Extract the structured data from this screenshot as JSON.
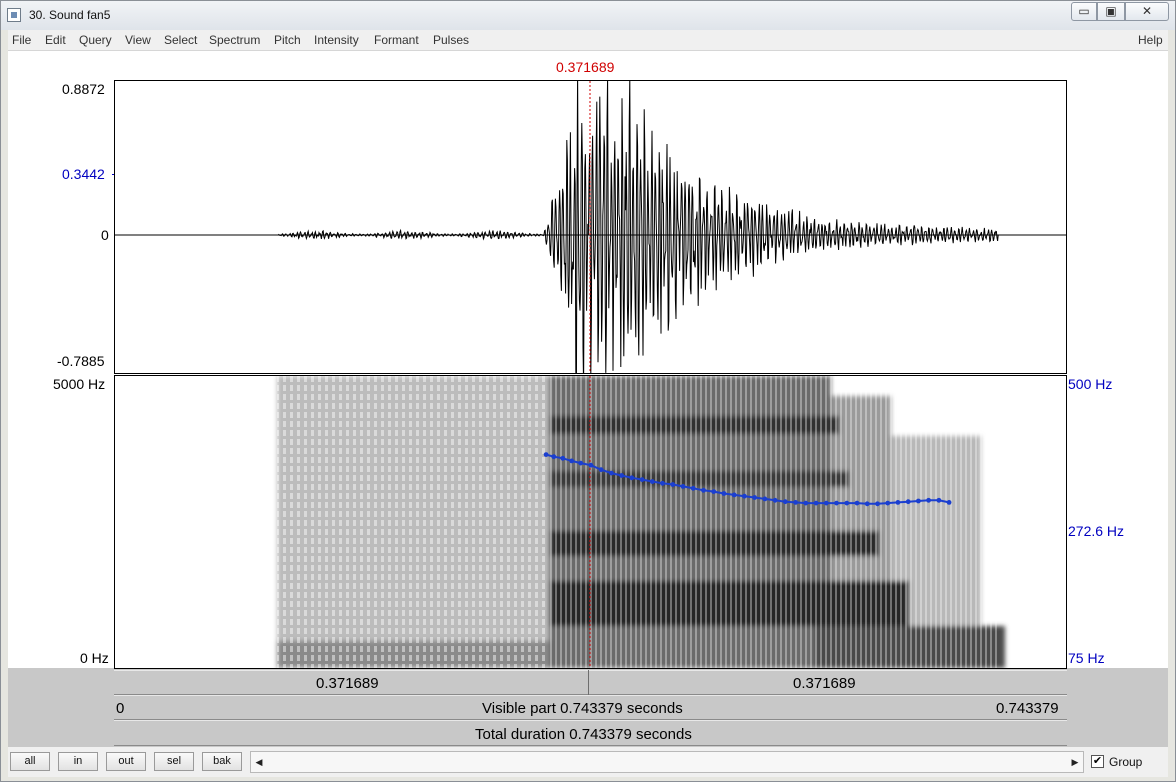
{
  "window": {
    "title": "30. Sound fan5",
    "controls": {
      "minimize": "▭",
      "maximize": "▣",
      "close": "✕"
    }
  },
  "menu": {
    "items": [
      "File",
      "Edit",
      "Query",
      "View",
      "Select",
      "Spectrum",
      "Pitch",
      "Intensity",
      "Formant",
      "Pulses"
    ],
    "help": "Help"
  },
  "cursor": {
    "time_label": "0.371689",
    "time": 0.371689,
    "color": "#d00000"
  },
  "waveform": {
    "y_max": "0.8872",
    "y_cursor": "0.3442",
    "y_zero": "0",
    "y_min": "-0.7885",
    "range": [
      -0.7885,
      0.8872
    ]
  },
  "spectrogram": {
    "freq_max": "5000 Hz",
    "freq_min": "0 Hz",
    "pitch_top": "500 Hz",
    "pitch_cursor": "272.6 Hz",
    "pitch_bottom": "75 Hz",
    "pitch_color": "#1b3fd0"
  },
  "chart_data": {
    "type": "line",
    "title": "",
    "xlabel": "",
    "ylabel": "",
    "xlim": [
      0,
      0.743379
    ],
    "ylim": [
      75,
      500
    ],
    "y_scale": "log",
    "series": [
      {
        "x": [
          0.337,
          0.343,
          0.35,
          0.357,
          0.364,
          0.372,
          0.38,
          0.388,
          0.396,
          0.404,
          0.412,
          0.42,
          0.428,
          0.436,
          0.444,
          0.452,
          0.46,
          0.468,
          0.476,
          0.484,
          0.492,
          0.5,
          0.508,
          0.516,
          0.524,
          0.532,
          0.54,
          0.548,
          0.556,
          0.564,
          0.572,
          0.58,
          0.588,
          0.596,
          0.604,
          0.612,
          0.62,
          0.628,
          0.636,
          0.644,
          0.652
        ],
        "values": [
          300,
          296,
          293,
          288,
          284,
          280,
          272,
          266,
          262,
          258,
          255,
          252,
          249,
          247,
          244,
          241,
          238,
          236,
          233,
          231,
          229,
          227,
          225,
          223,
          221,
          220,
          219,
          219,
          219,
          219,
          219,
          219,
          218,
          218,
          219,
          220,
          221,
          222,
          223,
          223,
          220
        ]
      }
    ]
  },
  "time_axis": {
    "left_segment": "0.371689",
    "right_segment": "0.371689"
  },
  "visible": {
    "start": "0",
    "label": "Visible part 0.743379 seconds",
    "end": "0.743379"
  },
  "total": {
    "label": "Total duration 0.743379 seconds"
  },
  "buttons": {
    "all": "all",
    "in": "in",
    "out": "out",
    "sel": "sel",
    "bak": "bak"
  },
  "scroll": {
    "left": "◀",
    "right": "▶"
  },
  "group": {
    "label": "Group",
    "checked": "✔"
  }
}
